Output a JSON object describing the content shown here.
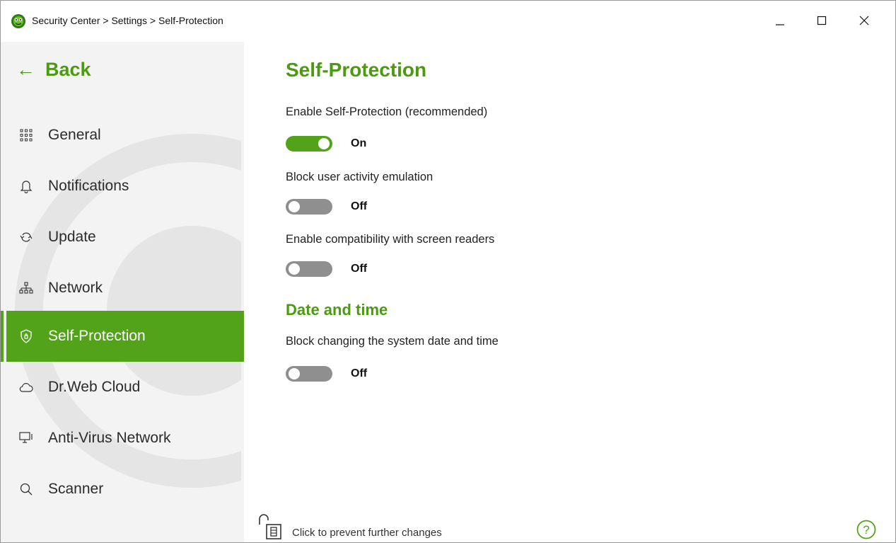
{
  "window": {
    "title": "Security Center > Settings > Self-Protection"
  },
  "sidebar": {
    "back_label": "Back",
    "items": [
      {
        "label": "General",
        "icon": "grid-icon"
      },
      {
        "label": "Notifications",
        "icon": "bell-icon"
      },
      {
        "label": "Update",
        "icon": "refresh-icon"
      },
      {
        "label": "Network",
        "icon": "network-icon"
      },
      {
        "label": "Self-Protection",
        "icon": "shield-icon",
        "active": true
      },
      {
        "label": "Dr.Web Cloud",
        "icon": "cloud-icon"
      },
      {
        "label": "Anti-Virus Network",
        "icon": "monitor-icon"
      },
      {
        "label": "Scanner",
        "icon": "search-icon"
      }
    ]
  },
  "main": {
    "title": "Self-Protection",
    "settings": [
      {
        "label": "Enable Self-Protection (recommended)",
        "state": "On",
        "enabled": true
      },
      {
        "label": "Block user activity emulation",
        "state": "Off",
        "enabled": false
      },
      {
        "label": "Enable compatibility with screen readers",
        "state": "Off",
        "enabled": false
      }
    ],
    "date_section": {
      "title": "Date and time",
      "settings": [
        {
          "label": "Block changing the system date and time",
          "state": "Off",
          "enabled": false
        }
      ]
    },
    "footer": {
      "lock_text": "Click to prevent further changes",
      "help_label": "?"
    }
  },
  "colors": {
    "accent": "#53a31a",
    "accent_text": "#4c9a10",
    "toggle_off": "#8f8f8f",
    "sidebar_bg": "#f3f3f3"
  }
}
